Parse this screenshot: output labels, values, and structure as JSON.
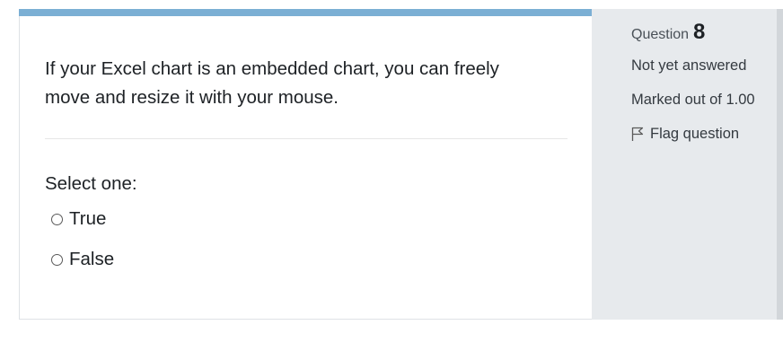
{
  "question": {
    "text": "If your Excel chart is an embedded chart, you can freely move and resize it with your mouse.",
    "prompt": "Select one:",
    "options": [
      {
        "label": "True",
        "selected": false
      },
      {
        "label": "False",
        "selected": false
      }
    ]
  },
  "info": {
    "question_label": "Question",
    "question_number": "8",
    "state": "Not yet answered",
    "grade": "Marked out of 1.00",
    "flag_label": "Flag question",
    "flag_icon": "flag-outline-icon"
  },
  "colors": {
    "accent_bar": "#7bafd4",
    "info_panel_bg": "#e7eaed",
    "text": "#1d2125"
  }
}
